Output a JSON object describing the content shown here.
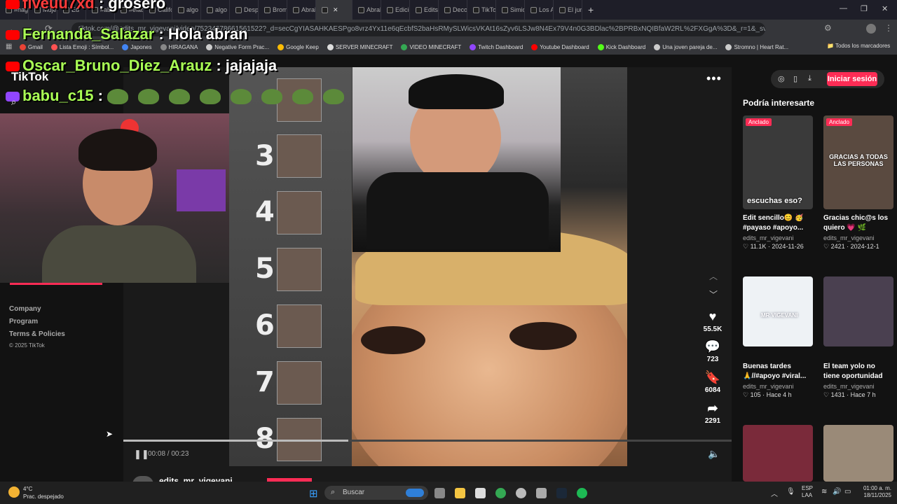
{
  "browser": {
    "tabs": [
      "#hagr",
      "Mujer",
      "Ed",
      "#abril",
      "#elabr",
      "Califc",
      "algo r",
      "algo r",
      "Despe",
      "Broma",
      "Abrah",
      "",
      "Abrah",
      "Edició",
      "Edits d",
      "Decor",
      "TikTok",
      "Simios",
      "Los Ab",
      "El jura"
    ],
    "new_tab": "+",
    "url": "tiktok.com/@edits_mr_vigevani/video/75234678661561522?_d=secCgYIASAHKAESPgo8vrz4Yx11e6qEcbfS2baHsRMySLWicsVKAt16sZyv6LSJw8N4Ex79V4n0G3BDlac%2BPRBxNQIBfaW2RL%2FXGgA%3D&_r=1&_svg=1&check..."
  },
  "bookmarks": [
    {
      "label": "Gmail",
      "color": "#ea4335"
    },
    {
      "label": "Lista Emoji : Símbol...",
      "color": "#ff5252"
    },
    {
      "label": "Japones",
      "color": "#4285f4"
    },
    {
      "label": "HIRAGANA",
      "color": "#888888"
    },
    {
      "label": "Negative Form Prac...",
      "color": "#cccccc"
    },
    {
      "label": "Google Keep",
      "color": "#fbbc04"
    },
    {
      "label": "SERVER MINECRAFT",
      "color": "#dddddd"
    },
    {
      "label": "VIDEO MINECRAFT",
      "color": "#34a853"
    },
    {
      "label": "Twitch Dashboard",
      "color": "#9146ff"
    },
    {
      "label": "Youtube Dashboard",
      "color": "#ff0000"
    },
    {
      "label": "Kick Dashboard",
      "color": "#53fc18"
    },
    {
      "label": "Una joven pareja de...",
      "color": "#cccccc"
    },
    {
      "label": "Stromno | Heart Rat...",
      "color": "#cccccc"
    }
  ],
  "all_bookmarks": "Todos los marcadores",
  "stream_chat": [
    {
      "user": "fiveuu7xd",
      "message": "grosero",
      "color": "red"
    },
    {
      "user": "Fernanda_Salazar",
      "message": "Hola abran",
      "color": "green"
    },
    {
      "user": "Oscar_Bruno_Diez_Arauz",
      "message": "jajajaja",
      "color": "green"
    },
    {
      "user": "babu_c15",
      "message": "",
      "color": "green"
    }
  ],
  "tiktok_logo": "TikTok",
  "leftnav": {
    "links": [
      "Company",
      "Program",
      "Terms & Policies"
    ],
    "copyright": "© 2025 TikTok"
  },
  "video": {
    "ranks": [
      "3",
      "4",
      "5",
      "6",
      "7",
      "8"
    ],
    "time": "00:08 / 00:23",
    "progress": 0.37,
    "author": "edits_mr_vigevani",
    "likes": "55.5K",
    "comments": "723",
    "saves": "6084",
    "shares": "2291",
    "more": "•••"
  },
  "header": {
    "login": "Iniciar sesión"
  },
  "suggestions": {
    "heading": "Podría interesarte",
    "cards": [
      {
        "pin": "Anclado",
        "thumb_text": "escuchas eso?",
        "title": "Edit sencillo😊 🥳 #payaso #apoyo...",
        "author": "edits_mr_vigevani",
        "meta": "♡ 11.1K · 2024-11-26",
        "bg": "#3a3a3a"
      },
      {
        "pin": "Anclado",
        "thumb_text": "GRACIAS A TODAS LAS PERSONAS",
        "title": "Gracias chic@s los quiero 💗 🌿 #apoy...",
        "author": "edits_mr_vigevani",
        "meta": "♡ 2421 · 2024-12-1",
        "bg": "#5a4a40"
      },
      {
        "pin": "",
        "thumb_text": "MR VIGEVANI",
        "title": "Buenas tardes 🙏//#apoyo #viral...",
        "author": "edits_mr_vigevani",
        "meta": "♡ 105 · Hace 4 h",
        "bg": "#dde4ea"
      },
      {
        "pin": "",
        "thumb_text": "",
        "title": "El team yolo no tiene oportunidad🔥...",
        "author": "edits_mr_vigevani",
        "meta": "♡ 1431 · Hace 7 h",
        "bg": "#4a4050"
      },
      {
        "pin": "",
        "thumb_text": "",
        "title": "",
        "author": "",
        "meta": "",
        "bg": "#7a2a3a"
      },
      {
        "pin": "",
        "thumb_text": "",
        "title": "",
        "author": "",
        "meta": "",
        "bg": "#9a8a78"
      }
    ]
  },
  "taskbar": {
    "weather_temp": "4°C",
    "weather_desc": "Prac. despejado",
    "search": "Buscar",
    "lang_top": "ESP",
    "lang_bottom": "LAA",
    "time": "01:00 a. m.",
    "date": "18/11/2025"
  }
}
